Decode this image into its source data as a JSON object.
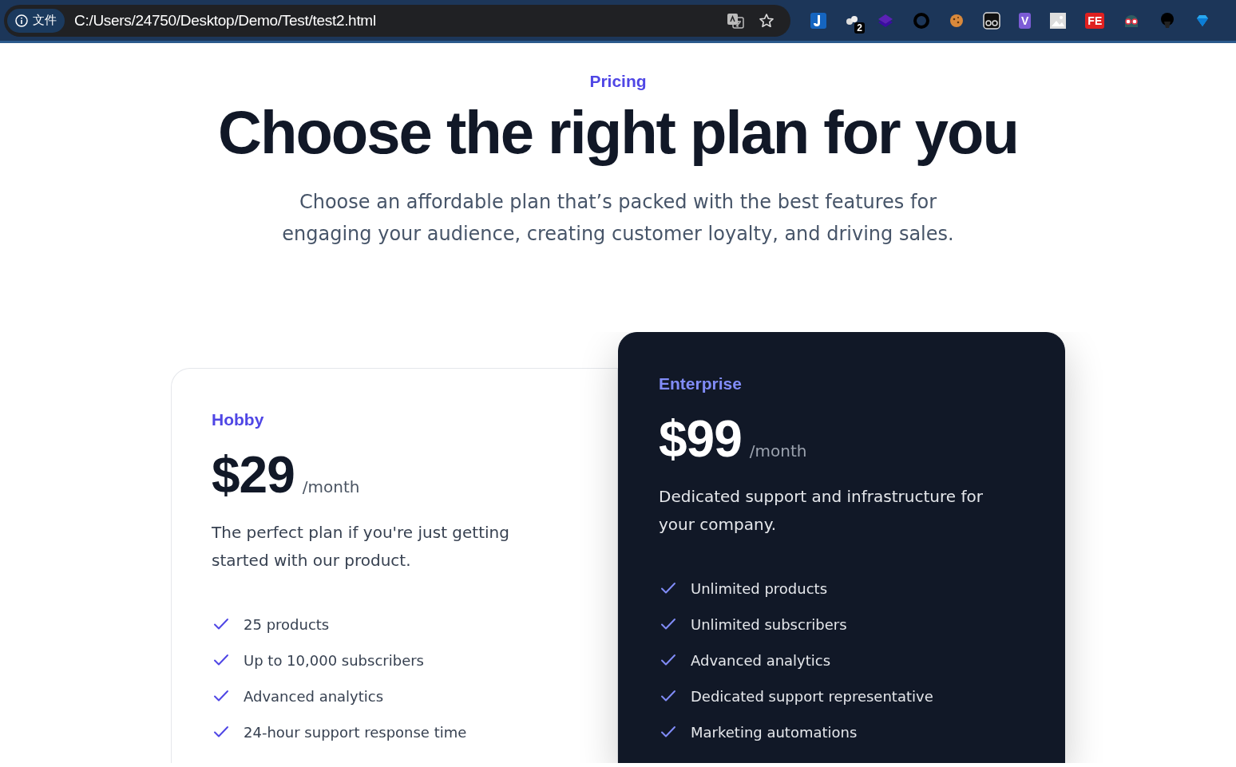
{
  "browser": {
    "security_label": "文件",
    "url": "C:/Users/24750/Desktop/Demo/Test/test2.html",
    "extensions": [
      {
        "kind": "j"
      },
      {
        "kind": "dots",
        "badge": "2"
      },
      {
        "kind": "layers"
      },
      {
        "kind": "ring"
      },
      {
        "kind": "cookie"
      },
      {
        "kind": "goggles"
      },
      {
        "kind": "tile",
        "label": "V",
        "color": "#7c5cd6"
      },
      {
        "kind": "image"
      },
      {
        "kind": "tile",
        "label": "FE",
        "color": "#e02020"
      },
      {
        "kind": "spy"
      },
      {
        "kind": "afro"
      },
      {
        "kind": "gem"
      }
    ]
  },
  "header": {
    "eyebrow": "Pricing",
    "title": "Choose the right plan for you",
    "subtitle": "Choose an affordable plan that’s packed with the best features for engaging your audience, creating customer loyalty, and driving sales."
  },
  "plans": [
    {
      "kind": "light",
      "name": "Hobby",
      "price": "$29",
      "period": "/month",
      "description": "The perfect plan if you're just getting started with our product.",
      "features": [
        "25 products",
        "Up to 10,000 subscribers",
        "Advanced analytics",
        "24-hour support response time"
      ]
    },
    {
      "kind": "dark",
      "name": "Enterprise",
      "price": "$99",
      "period": "/month",
      "description": "Dedicated support and infrastructure for your company.",
      "features": [
        "Unlimited products",
        "Unlimited subscribers",
        "Advanced analytics",
        "Dedicated support representative",
        "Marketing automations"
      ]
    }
  ]
}
